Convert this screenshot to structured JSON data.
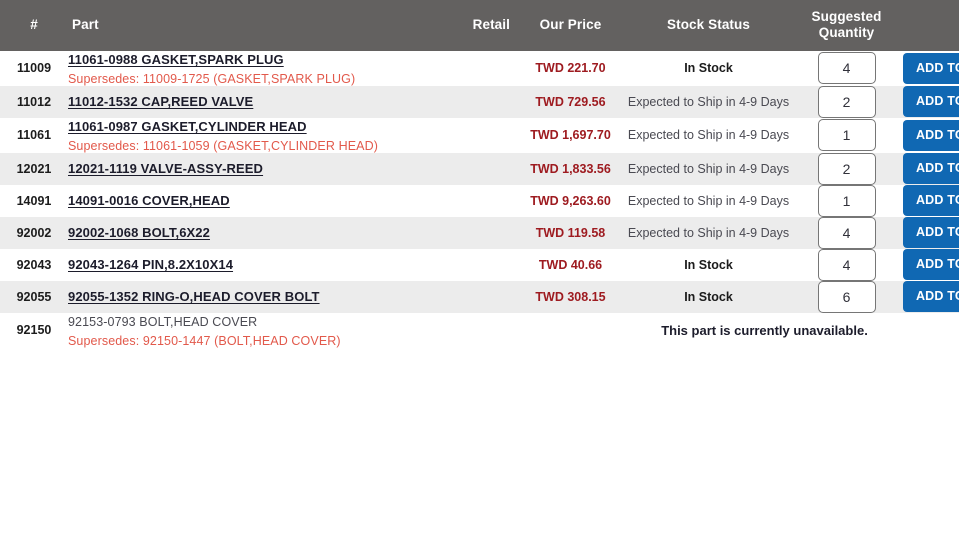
{
  "table": {
    "columns": {
      "number": "#",
      "part": "Part",
      "retail": "Retail",
      "our_price": "Our Price",
      "stock_status": "Stock Status",
      "suggested_quantity": "Suggested Quantity",
      "action": ""
    },
    "colors": {
      "header_bg": "#636160",
      "stripe_bg": "#ececec",
      "price_text": "#9e1b20",
      "supersedes_text": "#e2594b",
      "button_bg": "#1068b3",
      "link_text": "#1c1c2b"
    },
    "unavailable_message": "This part is currently unavailable.",
    "add_to_cart_label": "ADD TO CART",
    "rows": [
      {
        "number": "11009",
        "part_name": "11061-0988 GASKET,SPARK PLUG",
        "supersedes": "Supersedes: 11009-1725 (GASKET,SPARK PLUG)",
        "retail": "",
        "price": "TWD 221.70",
        "stock_status": "In Stock",
        "in_stock": true,
        "quantity": "4",
        "available": true
      },
      {
        "number": "11012",
        "part_name": "11012-1532 CAP,REED VALVE",
        "supersedes": "",
        "retail": "",
        "price": "TWD 729.56",
        "stock_status": "Expected to Ship in 4-9 Days",
        "in_stock": false,
        "quantity": "2",
        "available": true
      },
      {
        "number": "11061",
        "part_name": "11061-0987 GASKET,CYLINDER HEAD",
        "supersedes": "Supersedes: 11061-1059 (GASKET,CYLINDER HEAD)",
        "retail": "",
        "price": "TWD 1,697.70",
        "stock_status": "Expected to Ship in 4-9 Days",
        "in_stock": false,
        "quantity": "1",
        "available": true
      },
      {
        "number": "12021",
        "part_name": "12021-1119 VALVE-ASSY-REED",
        "supersedes": "",
        "retail": "",
        "price": "TWD 1,833.56",
        "stock_status": "Expected to Ship in 4-9 Days",
        "in_stock": false,
        "quantity": "2",
        "available": true
      },
      {
        "number": "14091",
        "part_name": "14091-0016 COVER,HEAD",
        "supersedes": "",
        "retail": "",
        "price": "TWD 9,263.60",
        "stock_status": "Expected to Ship in 4-9 Days",
        "in_stock": false,
        "quantity": "1",
        "available": true
      },
      {
        "number": "92002",
        "part_name": "92002-1068 BOLT,6X22",
        "supersedes": "",
        "retail": "",
        "price": "TWD 119.58",
        "stock_status": "Expected to Ship in 4-9 Days",
        "in_stock": false,
        "quantity": "4",
        "available": true
      },
      {
        "number": "92043",
        "part_name": "92043-1264 PIN,8.2X10X14",
        "supersedes": "",
        "retail": "",
        "price": "TWD 40.66",
        "stock_status": "In Stock",
        "in_stock": true,
        "quantity": "4",
        "available": true
      },
      {
        "number": "92055",
        "part_name": "92055-1352 RING-O,HEAD COVER BOLT",
        "supersedes": "",
        "retail": "",
        "price": "TWD 308.15",
        "stock_status": "In Stock",
        "in_stock": true,
        "quantity": "6",
        "available": true
      },
      {
        "number": "92150",
        "part_name": "92153-0793 BOLT,HEAD COVER",
        "supersedes": "Supersedes: 92150-1447 (BOLT,HEAD COVER)",
        "retail": "",
        "price": "",
        "stock_status": "",
        "in_stock": false,
        "quantity": "",
        "available": false
      }
    ]
  }
}
